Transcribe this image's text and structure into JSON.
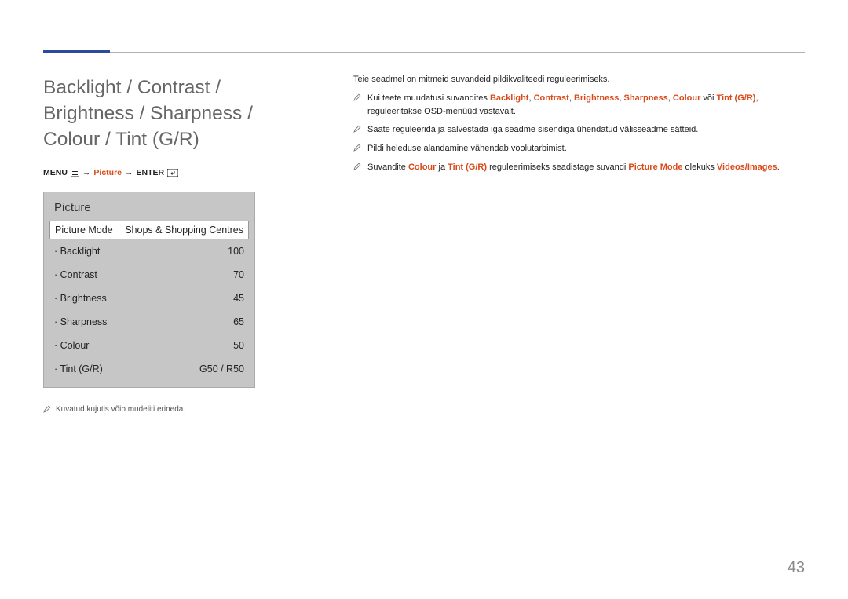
{
  "page_number": "43",
  "section_title": "Backlight / Contrast / Brightness / Sharpness / Colour / Tint (G/R)",
  "breadcrumb": {
    "menu": "MENU",
    "arrow": "→",
    "picture": "Picture",
    "enter": "ENTER"
  },
  "panel": {
    "title": "Picture",
    "mode_label": "Picture Mode",
    "mode_value": "Shops & Shopping Centres",
    "settings": [
      {
        "label": "Backlight",
        "value": "100"
      },
      {
        "label": "Contrast",
        "value": "70"
      },
      {
        "label": "Brightness",
        "value": "45"
      },
      {
        "label": "Sharpness",
        "value": "65"
      },
      {
        "label": "Colour",
        "value": "50"
      },
      {
        "label": "Tint (G/R)",
        "value": "G50 / R50"
      }
    ]
  },
  "panel_note": "Kuvatud kujutis võib mudeliti erineda.",
  "right": {
    "intro": "Teie seadmel on mitmeid suvandeid pildikvaliteedi reguleerimiseks.",
    "b1_a": "Kui teete muudatusi suvandites ",
    "b1_hl1": "Backlight",
    "b1_sep": ", ",
    "b1_hl2": "Contrast",
    "b1_hl3": "Brightness",
    "b1_hl4": "Sharpness",
    "b1_hl5": "Colour",
    "b1_or": " või ",
    "b1_hl6": "Tint (G/R)",
    "b1_b": ", reguleeritakse OSD-menüüd vastavalt.",
    "b2": "Saate reguleerida ja salvestada iga seadme sisendiga ühendatud välisseadme sätteid.",
    "b3": "Pildi heleduse alandamine vähendab voolutarbimist.",
    "b4_a": "Suvandite ",
    "b4_hl1": "Colour",
    "b4_and": " ja ",
    "b4_hl2": "Tint (G/R)",
    "b4_b": " reguleerimiseks seadistage suvandi ",
    "b4_hl3": "Picture Mode",
    "b4_c": " olekuks ",
    "b4_hl4": "Videos/Images",
    "b4_d": "."
  }
}
